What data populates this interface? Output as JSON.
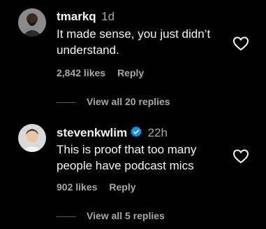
{
  "colors": {
    "background": "#000000",
    "text": "#f5f5f5",
    "muted": "#a8a8a8",
    "verified": "#0095f6"
  },
  "comments": [
    {
      "username": "tmarkq",
      "time": "1d",
      "verified": false,
      "text": "It made sense, you just didn’t understand.",
      "likes": "2,842 likes",
      "reply_label": "Reply",
      "view_replies": "View all 20 replies",
      "avatar_icon": "avatar-photo"
    },
    {
      "username": "stevenkwlim",
      "time": "22h",
      "verified": true,
      "text": "This is proof that too many people have podcast mics",
      "likes": "902 likes",
      "reply_label": "Reply",
      "view_replies": "View all 5 replies",
      "avatar_icon": "avatar-photo"
    }
  ]
}
